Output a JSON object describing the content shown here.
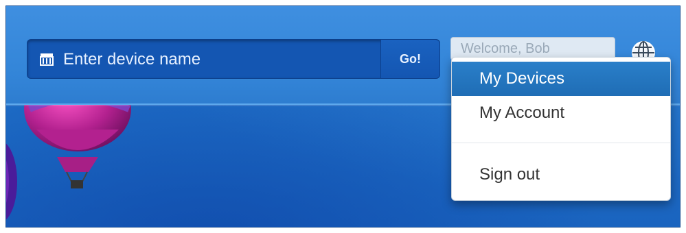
{
  "search": {
    "placeholder": "Enter device name",
    "go_label": "Go!",
    "icon": "device-icon"
  },
  "header": {
    "welcome_text": "Welcome, Bob",
    "globe_icon": "globe-icon"
  },
  "menu": {
    "items": [
      {
        "label": "My Devices",
        "active": true
      },
      {
        "label": "My Account",
        "active": false
      },
      {
        "label": "Sign out",
        "active": false
      }
    ]
  },
  "colors": {
    "sky": "#1f6fc8",
    "navbar": "#3385d8",
    "search_bg": "#1456b2",
    "menu_active": "#1f6db5",
    "menu_bg": "#ffffff"
  }
}
